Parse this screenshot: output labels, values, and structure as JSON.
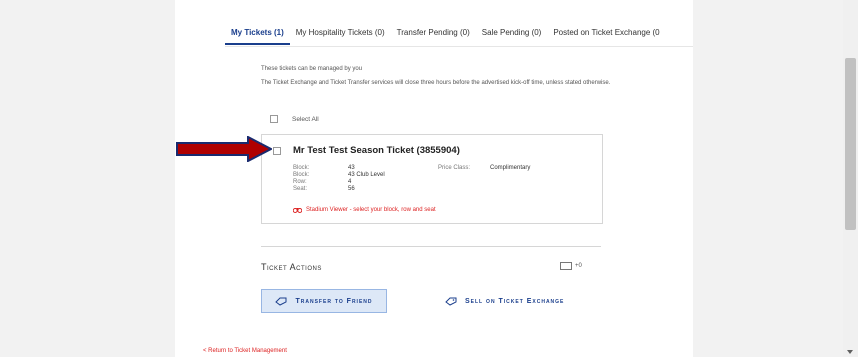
{
  "tabs": [
    {
      "label": "My Tickets (1)"
    },
    {
      "label": "My Hospitality Tickets (0)"
    },
    {
      "label": "Transfer Pending (0)"
    },
    {
      "label": "Sale Pending (0)"
    },
    {
      "label": "Posted on Ticket Exchange (0"
    }
  ],
  "intro": {
    "line1": "These tickets can be managed by you",
    "line2": "The Ticket Exchange and Ticket Transfer services will close three hours before the advertised kick-off time, unless stated otherwise."
  },
  "select_all_label": "Select All",
  "ticket": {
    "title": "Mr Test Test Season Ticket (3855904)",
    "details": [
      {
        "label": "Block:",
        "value": "43"
      },
      {
        "label": "Block:",
        "value": "43 Club Level"
      },
      {
        "label": "Row:",
        "value": "4"
      },
      {
        "label": "Seat:",
        "value": "56"
      }
    ],
    "price_class_label": "Price Class:",
    "price_class_value": "Complimentary",
    "stadium_viewer": "Stadium Viewer - select your block, row and seat"
  },
  "actions": {
    "title": "Ticket Actions",
    "count": "+0",
    "transfer_label": "Transfer to Friend",
    "sell_label": "Sell on Ticket Exchange"
  },
  "return_link": "< Return to Ticket Management",
  "colors": {
    "accent": "#1a3e8c",
    "link_red": "#dd2222",
    "arrow_red": "#b00000",
    "arrow_outline": "#1a2a6e"
  }
}
